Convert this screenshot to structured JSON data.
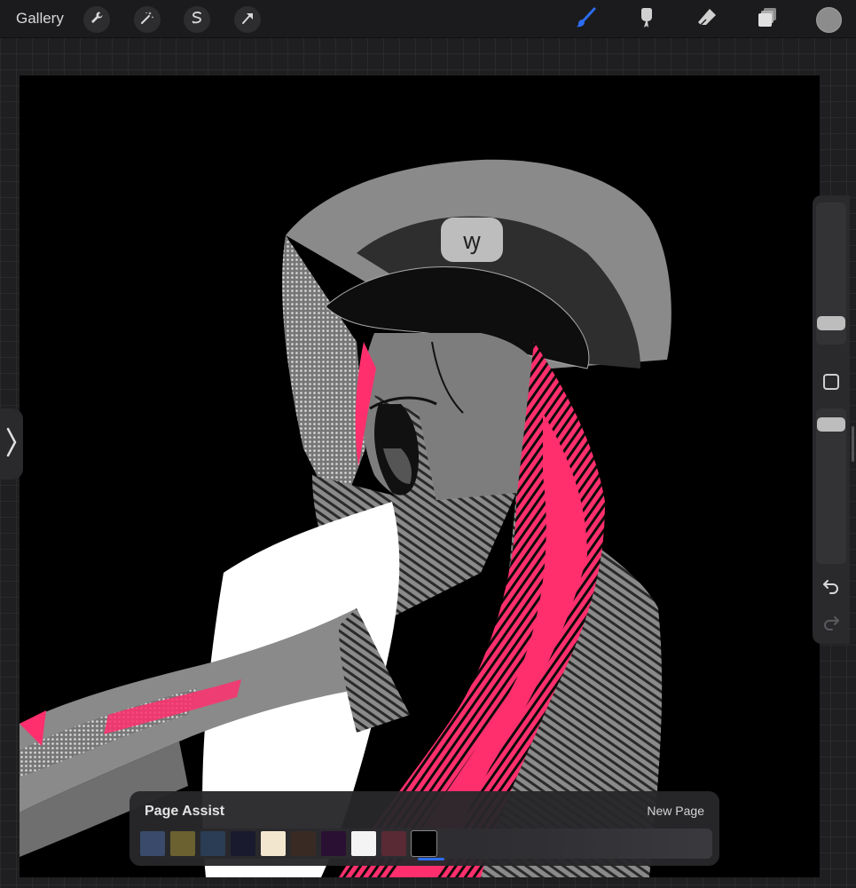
{
  "topbar": {
    "gallery_label": "Gallery",
    "left_tools": [
      "wrench-icon",
      "magic-wand-icon",
      "selection-icon",
      "transform-arrow-icon"
    ],
    "right_tools": [
      "brush-icon",
      "smudge-icon",
      "eraser-icon",
      "layers-icon"
    ],
    "active_tool": "brush-icon",
    "active_color": "#2d6cf0",
    "current_color": "#8c8c8c"
  },
  "sidebar": {
    "icons": [
      "modify-button",
      "undo-icon",
      "redo-icon"
    ]
  },
  "page_assist": {
    "title": "Page Assist",
    "new_page_label": "New Page",
    "thumbnails": [
      {
        "name": "page-thumb-1",
        "color": "#3a4a6a"
      },
      {
        "name": "page-thumb-2",
        "color": "#6b6030"
      },
      {
        "name": "page-thumb-3",
        "color": "#2a3d55"
      },
      {
        "name": "page-thumb-4",
        "color": "#1a1a2e"
      },
      {
        "name": "page-thumb-5",
        "color": "#f3e6cf"
      },
      {
        "name": "page-thumb-6",
        "color": "#3a2a24"
      },
      {
        "name": "page-thumb-7",
        "color": "#2a1033"
      },
      {
        "name": "page-thumb-8",
        "color": "#f4f4f4"
      },
      {
        "name": "page-thumb-9",
        "color": "#5a2a34"
      },
      {
        "name": "page-thumb-10",
        "color": "#000000"
      }
    ],
    "selected_index": 9
  },
  "artwork": {
    "colors": {
      "background": "#000000",
      "gray": "#8a8a8a",
      "dark_gray": "#4a4a4a",
      "pink": "#ff2f6d",
      "white": "#ffffff"
    }
  }
}
